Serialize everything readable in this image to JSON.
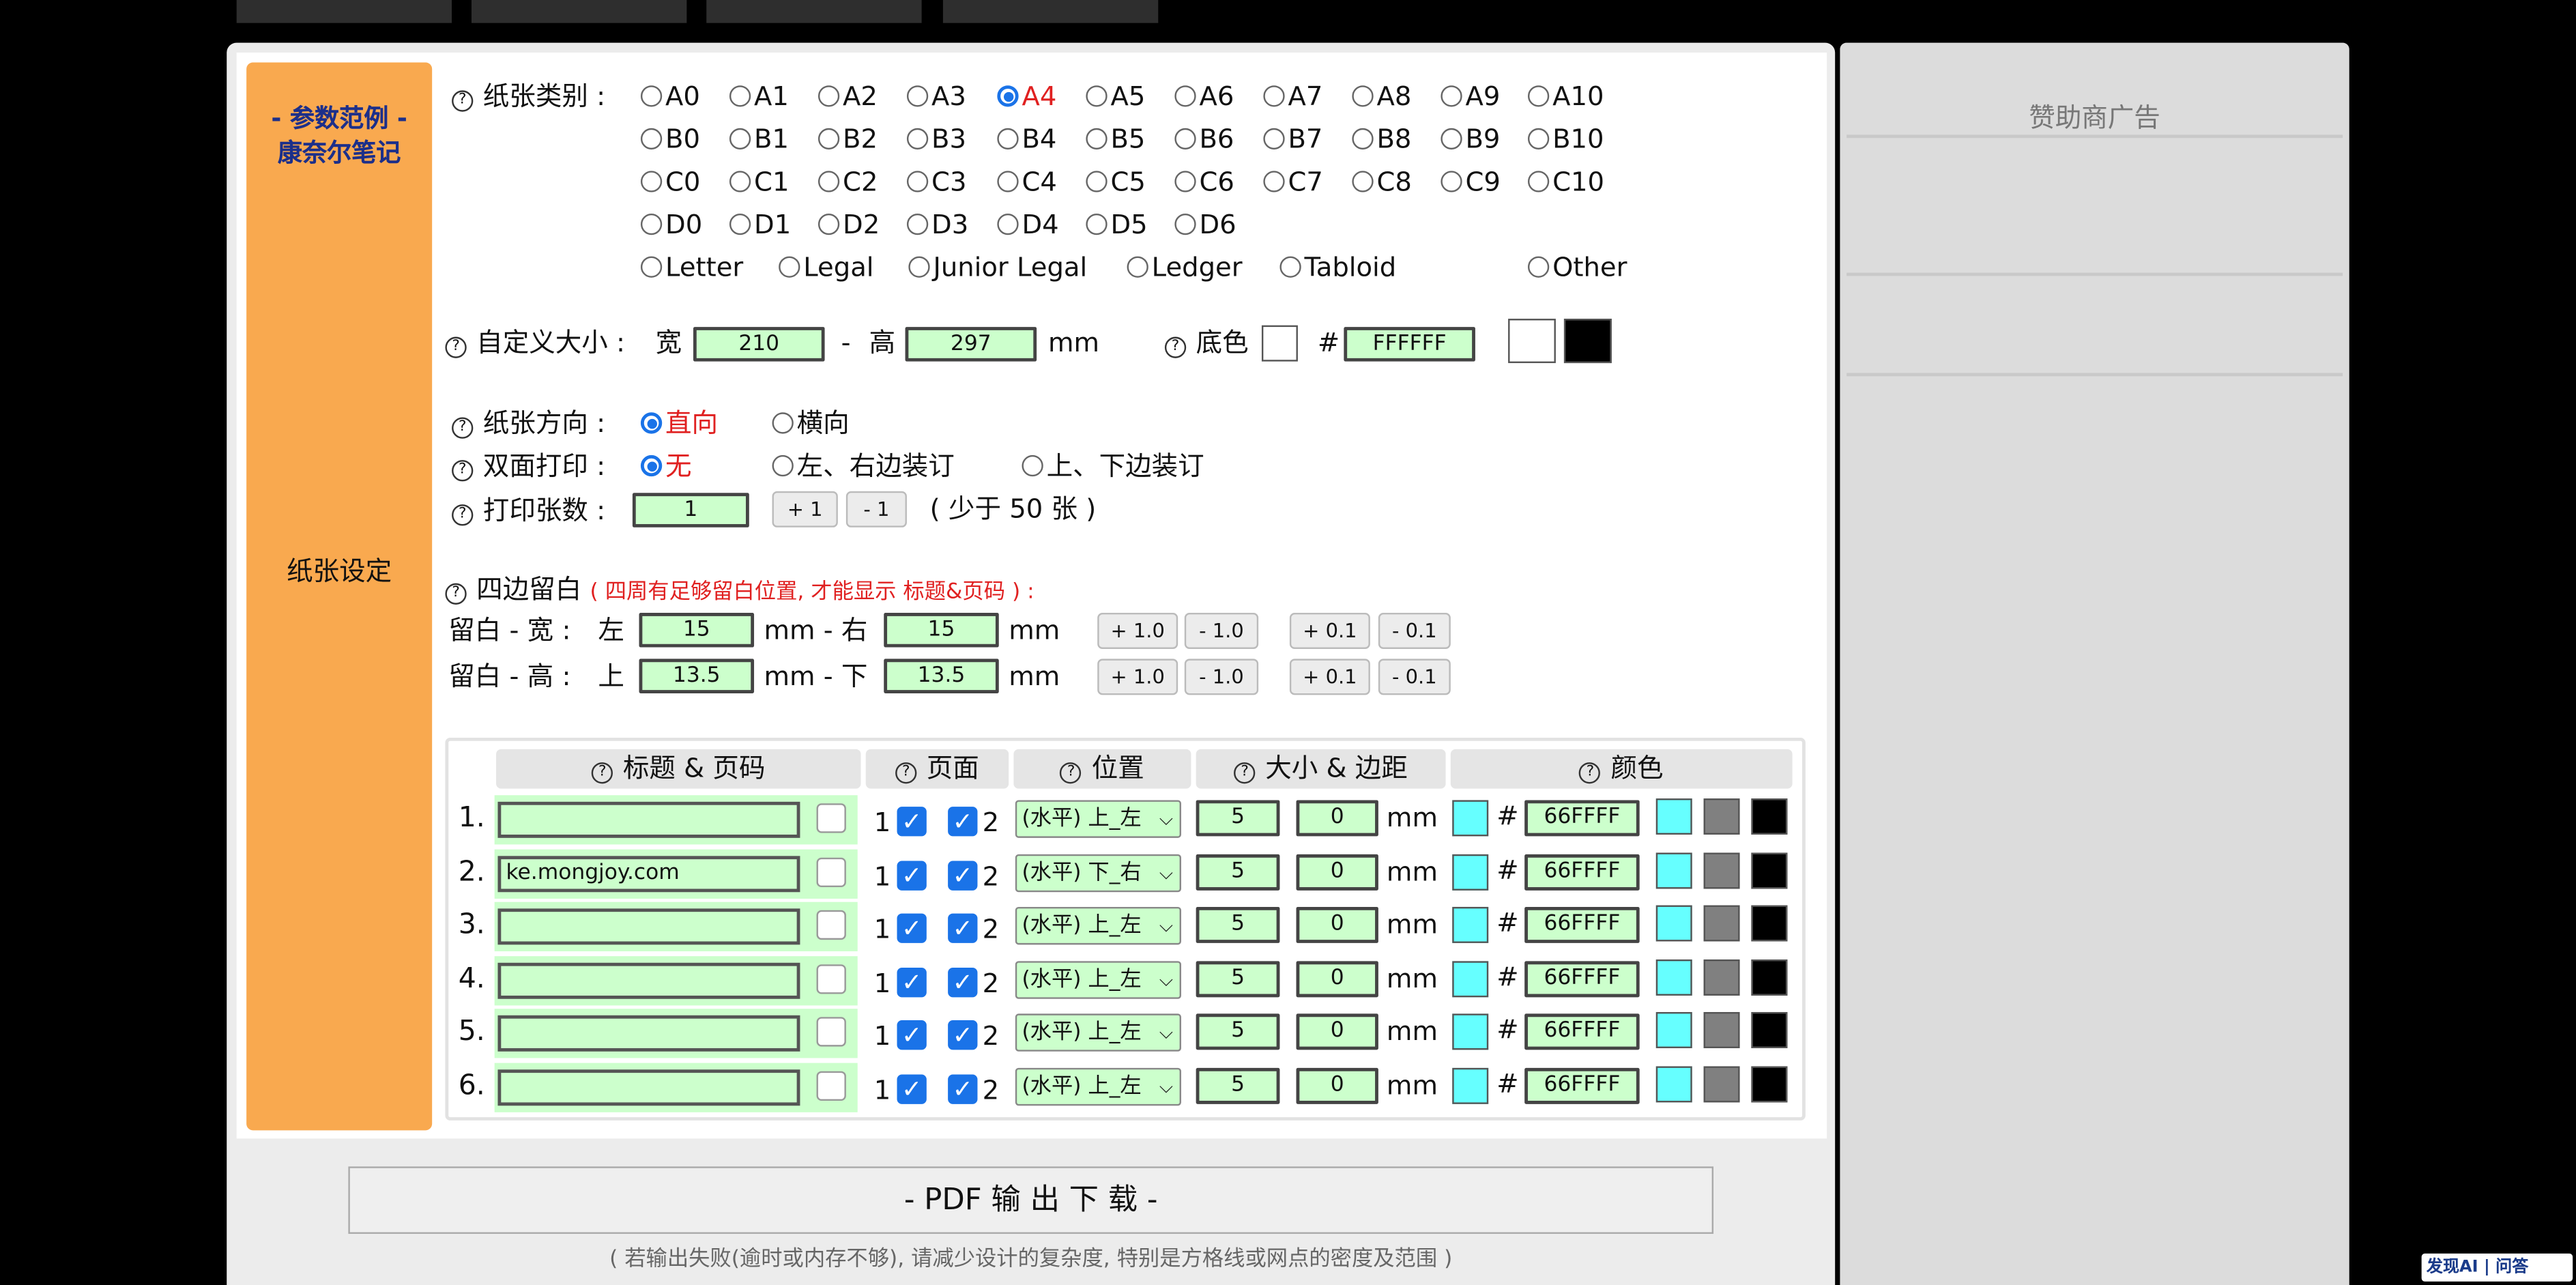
{
  "example": {
    "line1": "- 参数范例 -",
    "line2": "康奈尔笔记"
  },
  "side_label": "纸张设定",
  "ads_title": "赞助商广告",
  "paper": {
    "label": "纸张类别 :",
    "rows": [
      [
        "A0",
        "A1",
        "A2",
        "A3",
        "A4",
        "A5",
        "A6",
        "A7",
        "A8",
        "A9",
        "A10"
      ],
      [
        "B0",
        "B1",
        "B2",
        "B3",
        "B4",
        "B5",
        "B6",
        "B7",
        "B8",
        "B9",
        "B10"
      ],
      [
        "C0",
        "C1",
        "C2",
        "C3",
        "C4",
        "C5",
        "C6",
        "C7",
        "C8",
        "C9",
        "C10"
      ],
      [
        "D0",
        "D1",
        "D2",
        "D3",
        "D4",
        "D5",
        "D6"
      ]
    ],
    "special": [
      "Letter",
      "Legal",
      "Junior Legal",
      "Ledger",
      "Tabloid",
      "Other"
    ],
    "selected": "A4"
  },
  "custom": {
    "label": "自定义大小 :",
    "w_label": "宽",
    "width": "210",
    "dash": "-",
    "h_label": "高",
    "height": "297",
    "unit": "mm",
    "bg_label": "底色",
    "hash": "#",
    "bg_hex": "FFFFFF"
  },
  "orientation": {
    "label": "纸张方向 :",
    "options": [
      "直向",
      "横向"
    ],
    "selected": "直向"
  },
  "duplex": {
    "label": "双面打印 :",
    "options": [
      "无",
      "左、右边装订",
      "上、下边装订"
    ],
    "selected": "无"
  },
  "copies": {
    "label": "打印张数 :",
    "value": "1",
    "plus": "+ 1",
    "minus": "- 1",
    "note": "( 少于 50 张 )"
  },
  "margins": {
    "label": "四边留白",
    "warning": "( 四周有足够留白位置, 才能显示 标题&页码 ) :",
    "colon": ":",
    "w_row": {
      "label": "留白 - 宽 :",
      "a": "左",
      "a_val": "15",
      "mid": "mm - 右",
      "b_val": "15",
      "unit": "mm"
    },
    "h_row": {
      "label": "留白 - 高 :",
      "a": "上",
      "a_val": "13.5",
      "mid": "mm - 下",
      "b_val": "13.5",
      "unit": "mm"
    },
    "buttons": [
      "+ 1.0",
      "- 1.0",
      "+ 0.1",
      "- 0.1"
    ]
  },
  "table": {
    "headers": [
      "标题 & 页码",
      "页面",
      "位置",
      "大小 & 边距",
      "颜色"
    ],
    "unit": "mm",
    "hash": "#",
    "rows": [
      {
        "num": "1.",
        "text": "",
        "p1": "1",
        "p2": "2",
        "pos": "(水平) 上_左",
        "size": "5",
        "margin": "0",
        "color": "66FFFF"
      },
      {
        "num": "2.",
        "text": "ke.mongjoy.com",
        "p1": "1",
        "p2": "2",
        "pos": "(水平) 下_右",
        "size": "5",
        "margin": "0",
        "color": "66FFFF"
      },
      {
        "num": "3.",
        "text": "",
        "p1": "1",
        "p2": "2",
        "pos": "(水平) 上_左",
        "size": "5",
        "margin": "0",
        "color": "66FFFF"
      },
      {
        "num": "4.",
        "text": "",
        "p1": "1",
        "p2": "2",
        "pos": "(水平) 上_左",
        "size": "5",
        "margin": "0",
        "color": "66FFFF"
      },
      {
        "num": "5.",
        "text": "",
        "p1": "1",
        "p2": "2",
        "pos": "(水平) 上_左",
        "size": "5",
        "margin": "0",
        "color": "66FFFF"
      },
      {
        "num": "6.",
        "text": "",
        "p1": "1",
        "p2": "2",
        "pos": "(水平) 上_左",
        "size": "5",
        "margin": "0",
        "color": "66FFFF"
      }
    ]
  },
  "pdf_button": "- PDF 输 出 下 载 -",
  "pdf_note": "( 若输出失败(逾时或内存不够), 请减少设计的复杂度, 特别是方格线或网点的密度及范围 )",
  "logo_text": "发现AI | 问答",
  "colors": {
    "orange": "#f9a94f",
    "green_field": "#ccffcc",
    "cyan": "#66ffff",
    "radio_blue": "#1a73e8",
    "warn_red": "#e02020"
  }
}
